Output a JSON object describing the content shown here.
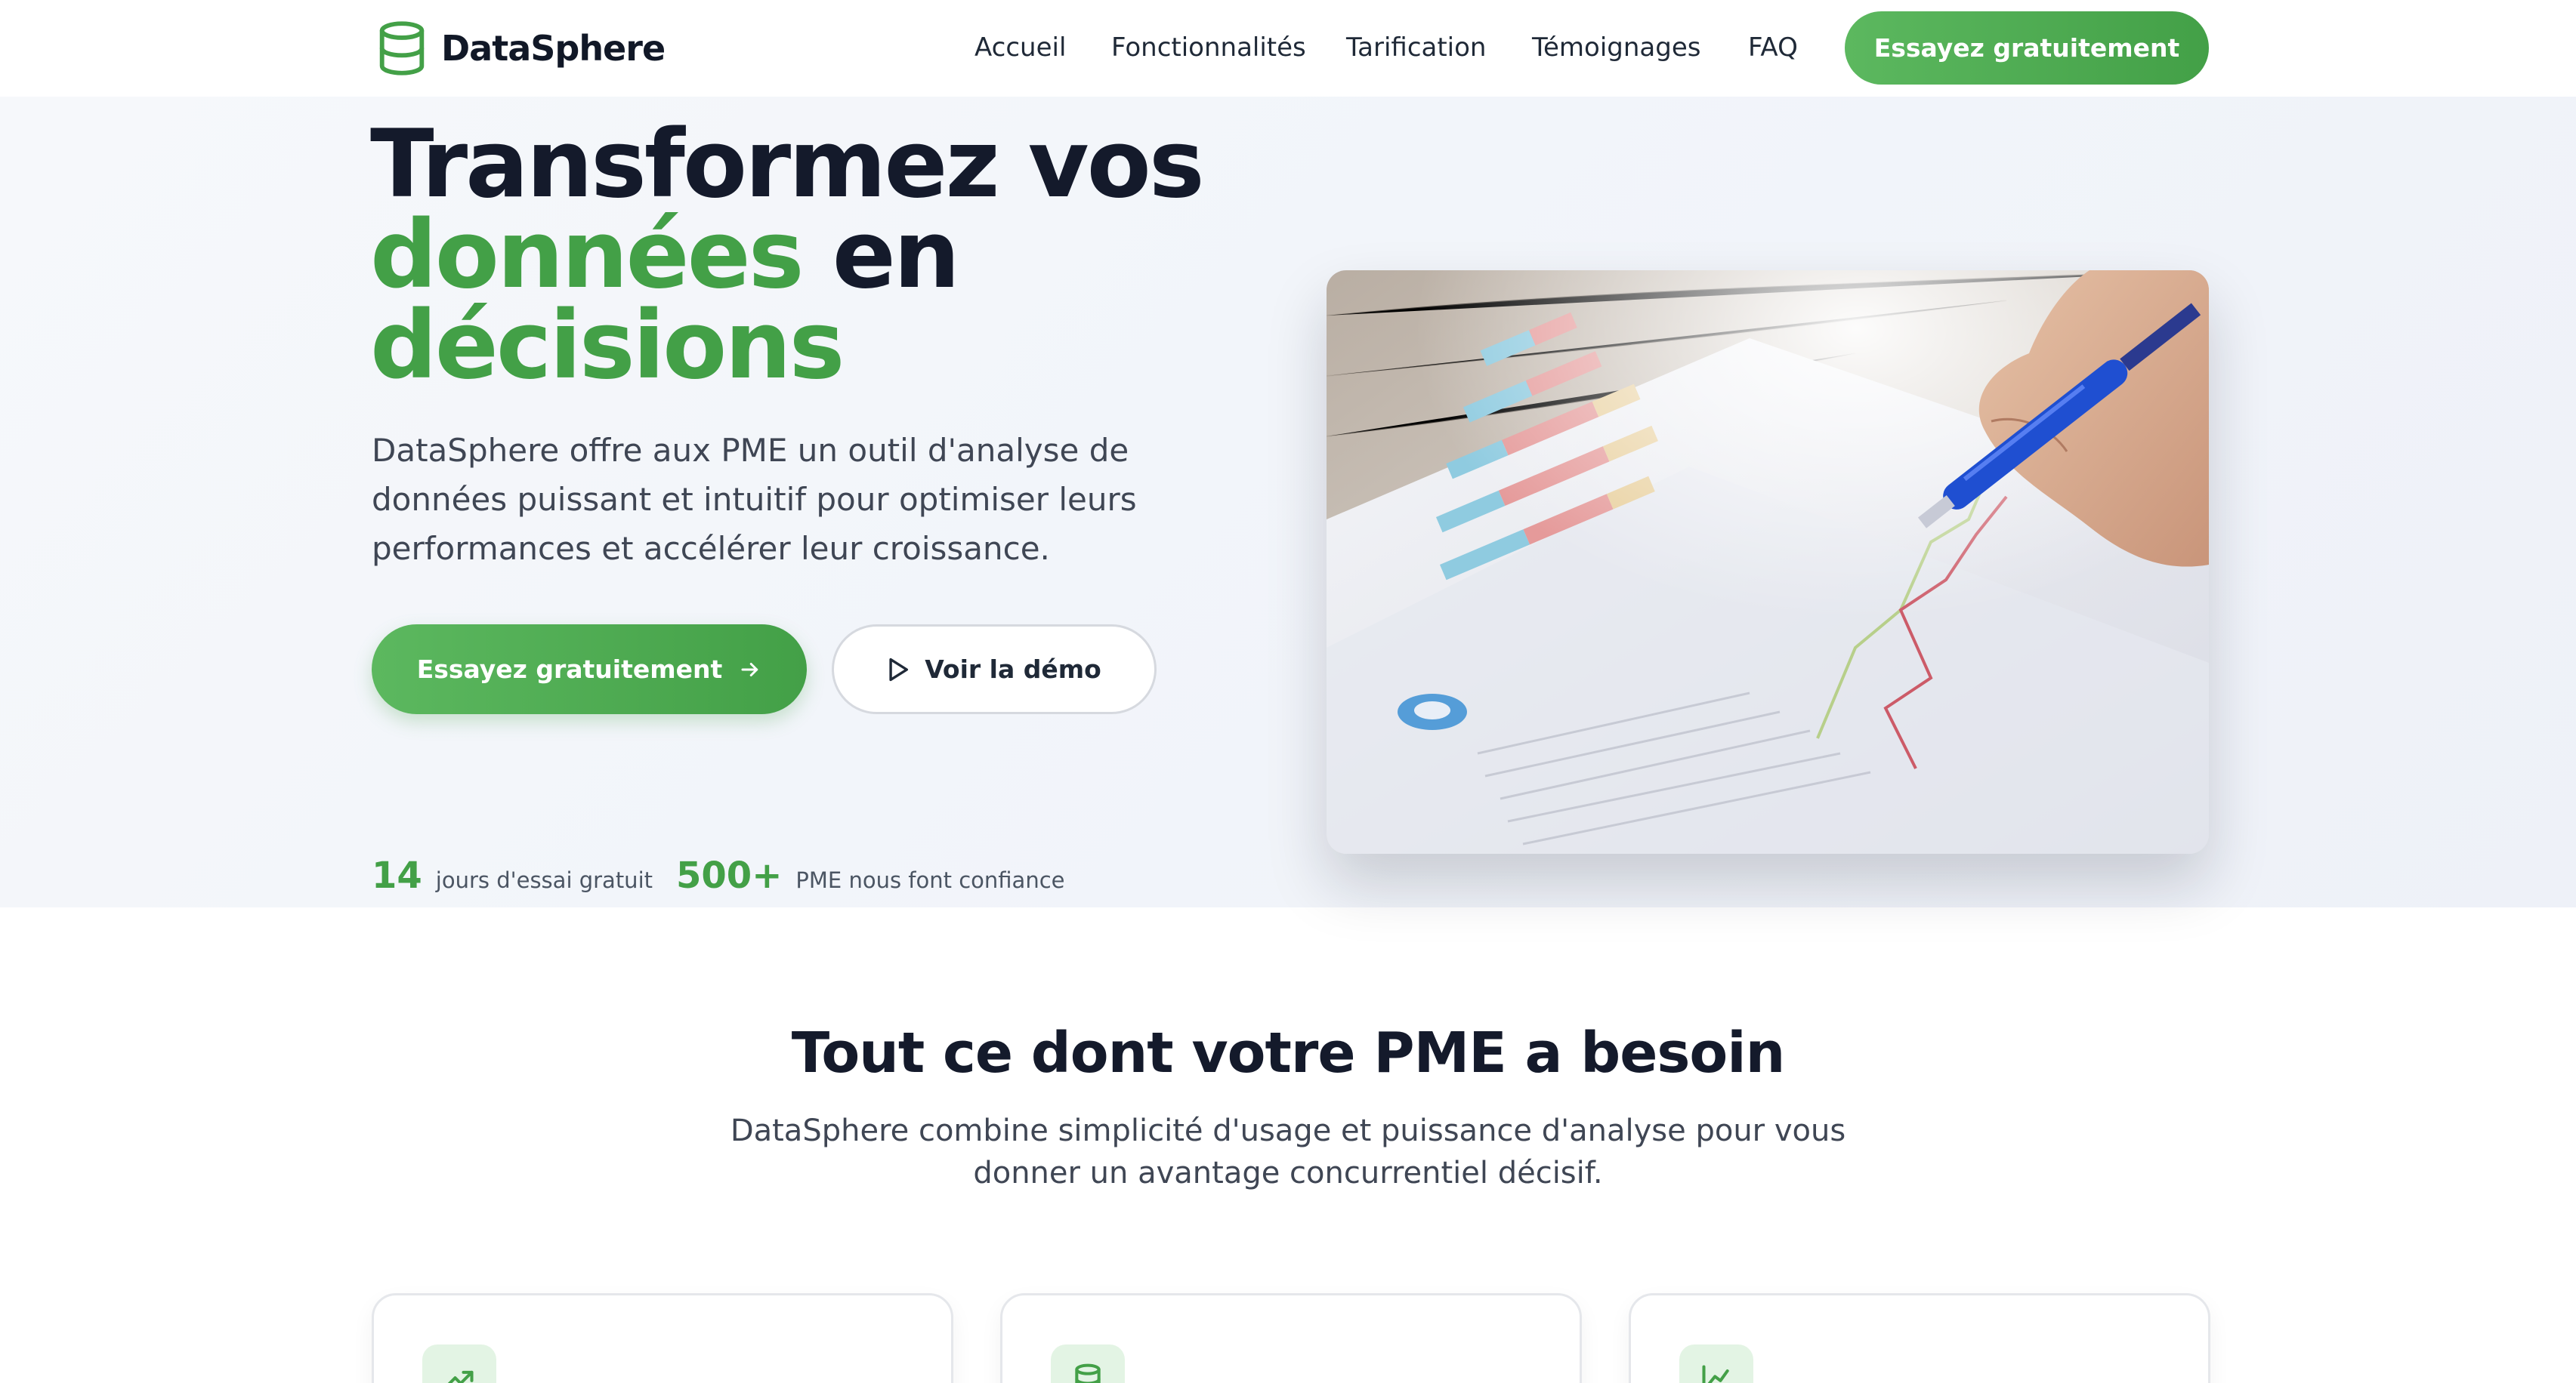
{
  "header": {
    "brand": "DataSphere",
    "logo_icon": "database-icon",
    "nav": [
      "Accueil",
      "Fonctionnalités",
      "Tarification",
      "Témoignages",
      "FAQ"
    ],
    "cta_label": "Essayez gratuitement"
  },
  "hero": {
    "title_line1": "Transformez vos",
    "title_green1": "données",
    "title_line2_rest": "en",
    "title_green2": "décisions",
    "description": "DataSphere offre aux PME un outil d'analyse de données puissant et intuitif pour optimiser leurs performances et accélérer leur croissance.",
    "primary_button": "Essayez gratuitement",
    "primary_icon": "arrow-right-icon",
    "secondary_button": "Voir la démo",
    "secondary_icon": "play-icon",
    "stats": [
      {
        "value": "14",
        "label": "jours d'essai gratuit"
      },
      {
        "value": "500+",
        "label": "PME nous font confiance"
      }
    ],
    "image_subject": "hand-with-pen-pointing-at-printed-bar-chart-photo"
  },
  "features": {
    "title": "Tout ce dont votre PME a besoin",
    "subtitle": "DataSphere combine simplicité d'usage et puissance d'analyse pour vous donner un avantage concurrentiel décisif.",
    "cards": [
      {
        "icon": "trending-up-icon"
      },
      {
        "icon": "database-icon"
      },
      {
        "icon": "line-chart-icon"
      }
    ]
  },
  "colors": {
    "accent": "#43a047",
    "accent_light": "#5cb85f",
    "text_dark": "#141a2b",
    "text_body": "#3f4654",
    "icon_bg": "#e3f4e4"
  }
}
